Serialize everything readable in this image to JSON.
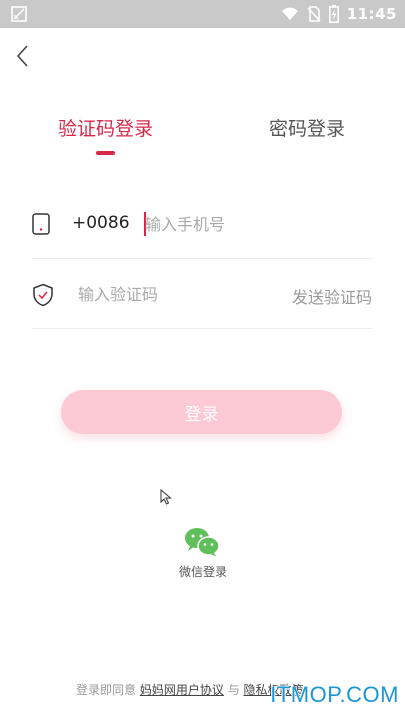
{
  "status_bar": {
    "time": "11:45",
    "icons": [
      "notification-icon",
      "wifi-icon",
      "no-sim-icon",
      "battery-charging-icon"
    ]
  },
  "header": {
    "back_icon": "chevron-left-icon"
  },
  "tabs": [
    {
      "label": "验证码登录",
      "active": true
    },
    {
      "label": "密码登录",
      "active": false
    }
  ],
  "form": {
    "phone": {
      "icon": "phone-icon",
      "country_code": "+0086",
      "placeholder": "输入手机号",
      "value": ""
    },
    "code": {
      "icon": "shield-check-icon",
      "placeholder": "输入验证码",
      "value": "",
      "send_label": "发送验证码"
    },
    "login_label": "登录"
  },
  "third_party": {
    "wechat_label": "微信登录",
    "icon": "wechat-icon"
  },
  "agreement": {
    "prefix": "登录即同意",
    "user_agreement": "妈妈网用户协议",
    "connector": "与",
    "privacy_policy": "隐私权政策"
  },
  "watermark": "ITMOP.COM",
  "colors": {
    "accent": "#d6294a",
    "login_button": "#fdc9d5",
    "wechat": "#5fbf5a",
    "status_bar": "#c9c9c9",
    "watermark": "#1a95d6"
  }
}
